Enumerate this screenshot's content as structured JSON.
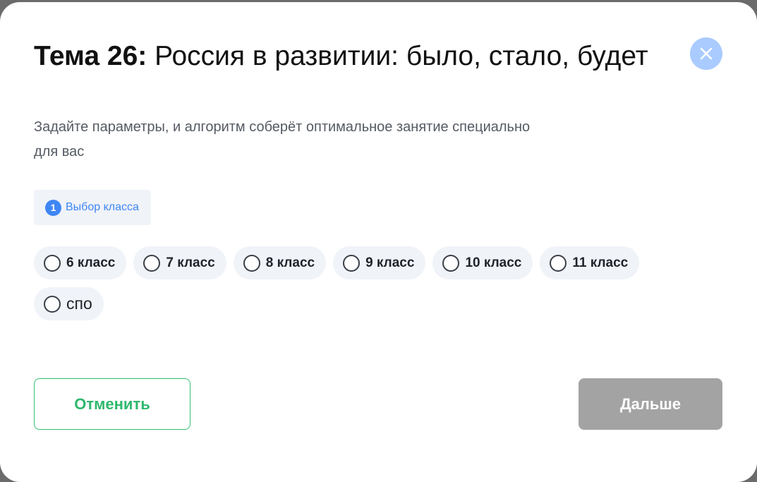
{
  "dialog": {
    "title_prefix": "Тема 26:",
    "title_text": "Россия в развитии: было, стало, будет",
    "subtitle": "Задайте параметры, и алгоритм соберёт оптимальное занятие специально для вас",
    "close_icon": "close-icon"
  },
  "step": {
    "number": "1",
    "label": "Выбор класса"
  },
  "grades": [
    {
      "label": "6 класс",
      "selected": false
    },
    {
      "label": "7 класс",
      "selected": false
    },
    {
      "label": "8 класс",
      "selected": false
    },
    {
      "label": "9 класс",
      "selected": false
    },
    {
      "label": "10 класс",
      "selected": false
    },
    {
      "label": "11 класс",
      "selected": false
    },
    {
      "label": "спо",
      "selected": false
    }
  ],
  "footer": {
    "cancel_label": "Отменить",
    "next_label": "Дальше"
  },
  "colors": {
    "accent_blue": "#3f86f5",
    "close_bg": "#a9cbff",
    "cancel_green": "#2fc274",
    "next_disabled": "#a3a3a3",
    "chip_bg": "#f0f3f8"
  }
}
